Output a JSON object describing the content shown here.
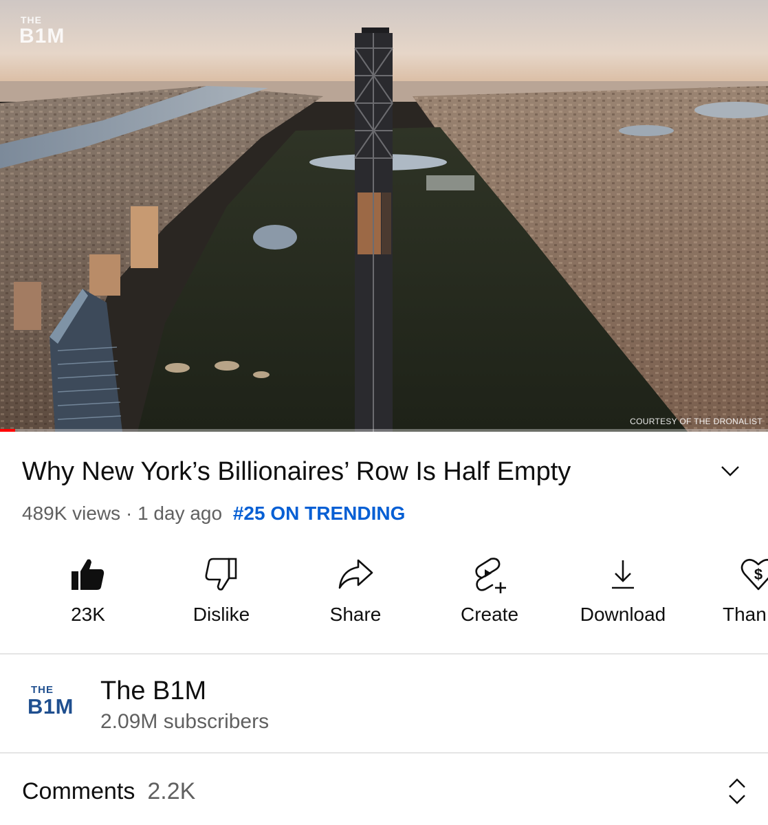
{
  "player": {
    "watermark_the": "THE",
    "watermark_b1m": "B1M",
    "courtesy_text": "COURTESY OF THE DRONALIST",
    "progress_fraction": 0.02,
    "progress_color": "#ff0000"
  },
  "video": {
    "title": "Why New York’s Billionaires’ Row Is Half Empty",
    "views": "489K views",
    "separator": "·",
    "age": "1 day ago",
    "trending": "#25 ON TRENDING",
    "expand_icon": "chevron-down-icon"
  },
  "actions": [
    {
      "id": "like",
      "label": "23K",
      "icon": "thumbs-up-filled-icon"
    },
    {
      "id": "dislike",
      "label": "Dislike",
      "icon": "thumbs-down-outline-icon"
    },
    {
      "id": "share",
      "label": "Share",
      "icon": "share-arrow-icon"
    },
    {
      "id": "create",
      "label": "Create",
      "icon": "create-shorts-icon"
    },
    {
      "id": "download",
      "label": "Download",
      "icon": "download-icon"
    },
    {
      "id": "thanks",
      "label": "Than",
      "icon": "heart-dollar-icon"
    }
  ],
  "channel": {
    "avatar_the": "THE",
    "avatar_b1m": "B1M",
    "name": "The B1M",
    "subscribers": "2.09M subscribers"
  },
  "comments": {
    "label": "Comments",
    "count": "2.2K",
    "toggle_icon": "expand-collapse-icon"
  },
  "colors": {
    "link_blue": "#065fd4",
    "secondary_text": "#606060",
    "divider": "#e5e5e5",
    "avatar_blue": "#1f4f8f"
  }
}
